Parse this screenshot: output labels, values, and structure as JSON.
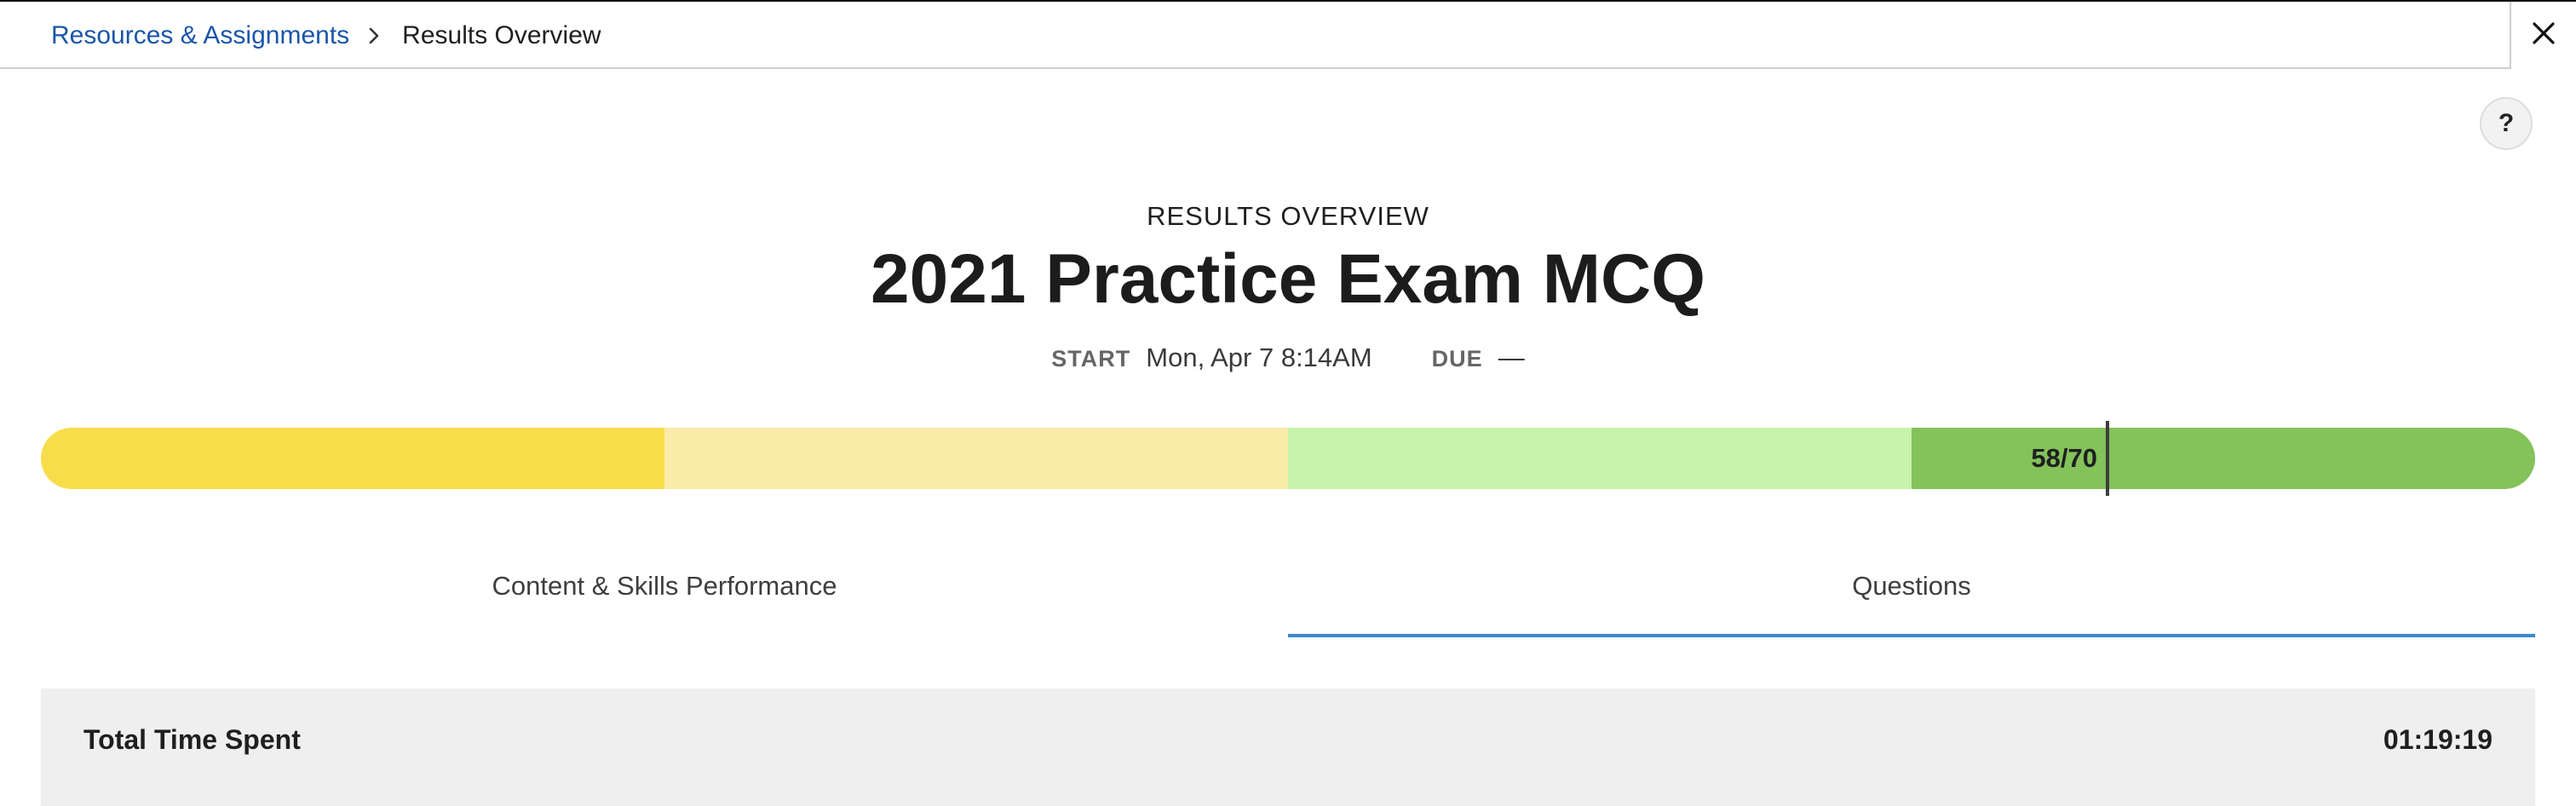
{
  "breadcrumb": {
    "parent": "Resources & Assignments",
    "current": "Results Overview",
    "separator_icon": "chevron-right-icon"
  },
  "close_icon": "close-icon",
  "help": {
    "label": "?"
  },
  "header": {
    "eyebrow": "RESULTS OVERVIEW",
    "title": "2021 Practice Exam MCQ",
    "start_label": "START",
    "start_value": "Mon, Apr 7 8:14AM",
    "due_label": "DUE",
    "due_value": "—"
  },
  "score": {
    "label": "58/70",
    "earned": 58,
    "total": 70,
    "segment_colors": [
      "#f8dd4a",
      "#fbeba8",
      "#c9f2ad",
      "#84c25a"
    ]
  },
  "tabs": [
    {
      "label": "Content & Skills Performance",
      "active": false
    },
    {
      "label": "Questions",
      "active": true
    }
  ],
  "summary": {
    "label": "Total Time Spent",
    "value": "01:19:19"
  },
  "colors": {
    "link": "#1a56a8",
    "tab_active_underline": "#3a8ad0"
  }
}
